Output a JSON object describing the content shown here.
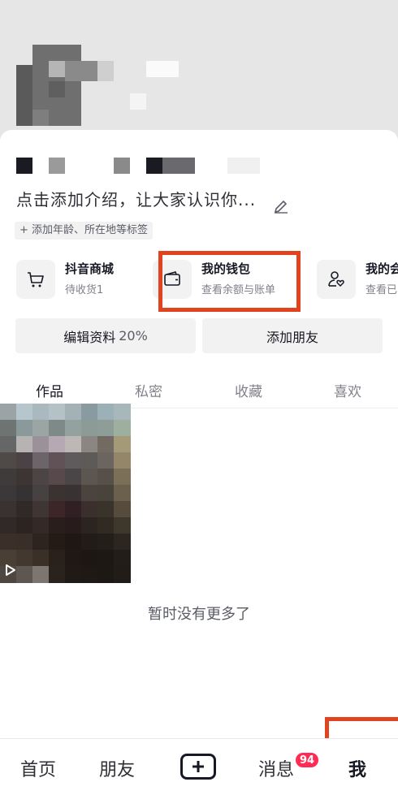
{
  "profile": {
    "bio_prompt": "点击添加介绍，让大家认识你...",
    "add_tags": "+ 添加年龄、所在地等标签"
  },
  "services": [
    {
      "title": "抖音商城",
      "subtitle": "待收货1",
      "icon": "cart-icon"
    },
    {
      "title": "我的钱包",
      "subtitle": "查看余额与账单",
      "icon": "wallet-icon"
    },
    {
      "title": "我的会",
      "subtitle": "查看已",
      "icon": "user-heart-icon"
    }
  ],
  "actions": {
    "edit_profile": "编辑资料",
    "edit_profile_percent": "20%",
    "add_friends": "添加朋友"
  },
  "tabs": [
    {
      "label": "作品",
      "active": true
    },
    {
      "label": "私密",
      "active": false
    },
    {
      "label": "收藏",
      "active": false
    },
    {
      "label": "喜欢",
      "active": false
    }
  ],
  "feed": {
    "empty_text": "暂时没有更多了"
  },
  "bottom_nav": {
    "home": "首页",
    "friends": "朋友",
    "messages": "消息",
    "messages_badge": "94",
    "me": "我"
  },
  "colors": {
    "highlight_box": "#e2431f",
    "badge": "#fe2c55"
  }
}
